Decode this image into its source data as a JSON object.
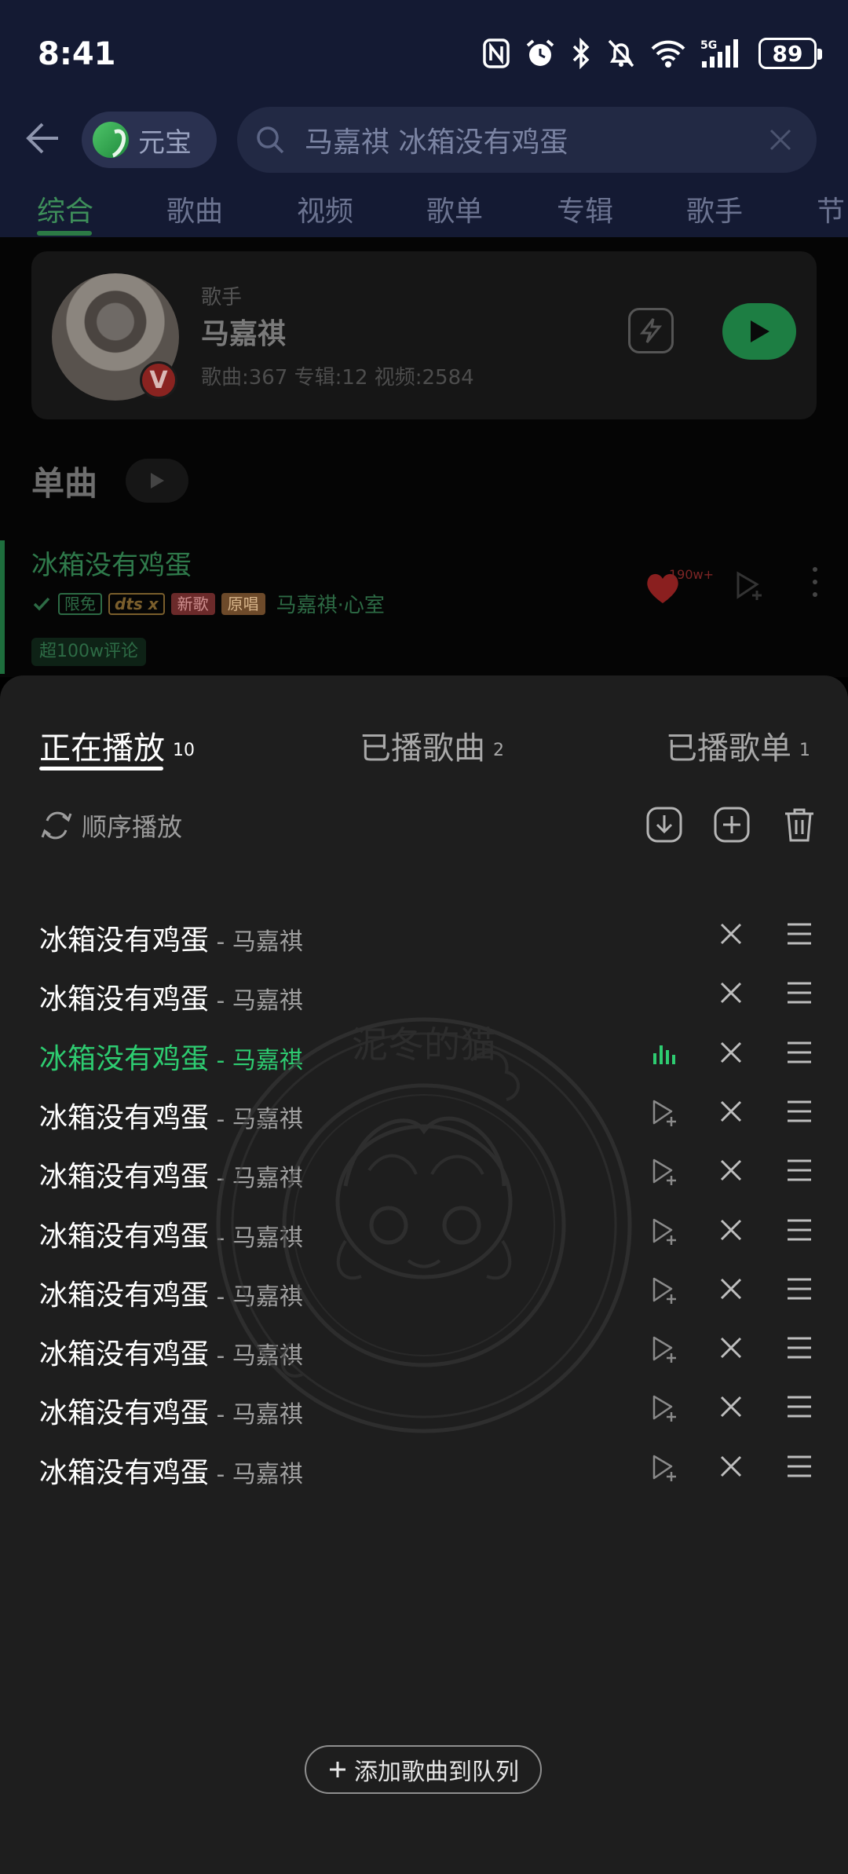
{
  "status_bar": {
    "time": "8:41",
    "battery": "89",
    "network": "5G",
    "icons": [
      "nfc-icon",
      "alarm-icon",
      "bluetooth-icon",
      "mute-icon",
      "wifi-icon",
      "signal-icon",
      "battery-icon"
    ]
  },
  "search": {
    "yuanbao_label": "元宝",
    "query": "马嘉祺 冰箱没有鸡蛋"
  },
  "tabs": [
    {
      "label": "综合",
      "active": true
    },
    {
      "label": "歌曲"
    },
    {
      "label": "视频"
    },
    {
      "label": "歌单"
    },
    {
      "label": "专辑"
    },
    {
      "label": "歌手"
    },
    {
      "label": "节"
    }
  ],
  "artist_card": {
    "type": "歌手",
    "name": "马嘉祺",
    "stats": "歌曲:367 专辑:12 视频:2584",
    "badge": "V"
  },
  "singles": {
    "title": "单曲",
    "song": {
      "title": "冰箱没有鸡蛋",
      "badges": [
        "限免",
        "dts x",
        "新歌",
        "原唱"
      ],
      "artist_album": "马嘉祺·心室",
      "comments": "超100w评论",
      "likes": "190w+"
    }
  },
  "queue_sheet": {
    "tabs": [
      {
        "label": "正在播放",
        "count": "10",
        "active": true
      },
      {
        "label": "已播歌曲",
        "count": "2"
      },
      {
        "label": "已播歌单",
        "count": "1"
      }
    ],
    "play_mode": "顺序播放",
    "items": [
      {
        "title": "冰箱没有鸡蛋",
        "artist": "马嘉祺",
        "playing": false,
        "add_next": false
      },
      {
        "title": "冰箱没有鸡蛋",
        "artist": "马嘉祺",
        "playing": false,
        "add_next": false
      },
      {
        "title": "冰箱没有鸡蛋",
        "artist": "马嘉祺",
        "playing": true,
        "add_next": false
      },
      {
        "title": "冰箱没有鸡蛋",
        "artist": "马嘉祺",
        "playing": false,
        "add_next": true
      },
      {
        "title": "冰箱没有鸡蛋",
        "artist": "马嘉祺",
        "playing": false,
        "add_next": true
      },
      {
        "title": "冰箱没有鸡蛋",
        "artist": "马嘉祺",
        "playing": false,
        "add_next": true
      },
      {
        "title": "冰箱没有鸡蛋",
        "artist": "马嘉祺",
        "playing": false,
        "add_next": true
      },
      {
        "title": "冰箱没有鸡蛋",
        "artist": "马嘉祺",
        "playing": false,
        "add_next": true
      },
      {
        "title": "冰箱没有鸡蛋",
        "artist": "马嘉祺",
        "playing": false,
        "add_next": true
      },
      {
        "title": "冰箱没有鸡蛋",
        "artist": "马嘉祺",
        "playing": false,
        "add_next": true
      }
    ],
    "add_button": "添加歌曲到队列"
  },
  "watermark": {
    "text": "泥冬的猫"
  },
  "colors": {
    "accent": "#2ecc71",
    "header_bg": "#141a33",
    "sheet_bg": "#1e1e1e"
  }
}
